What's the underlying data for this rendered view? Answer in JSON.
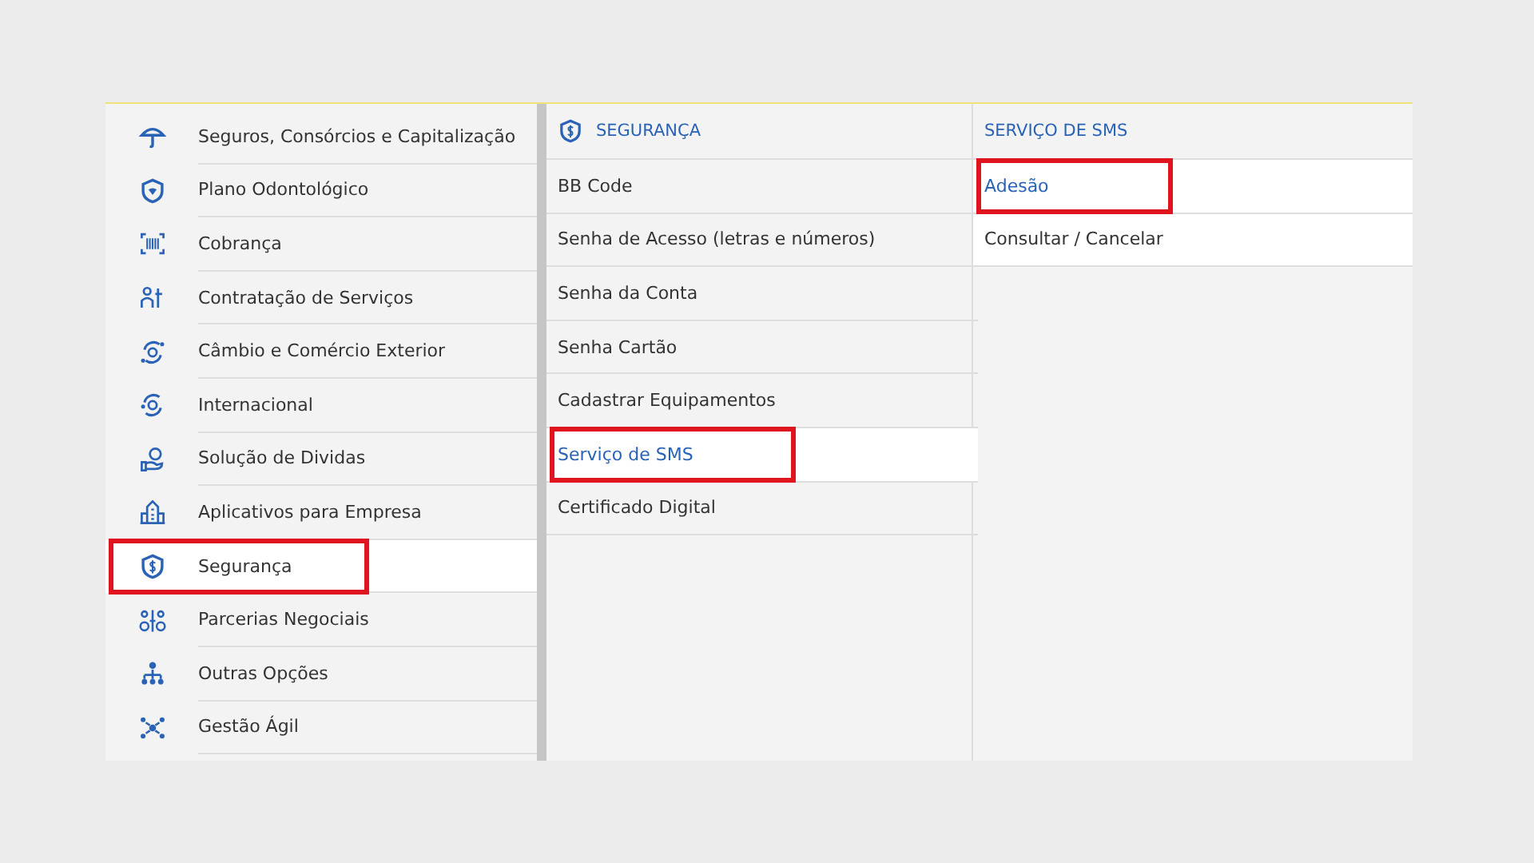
{
  "categories": [
    {
      "label": "Seguros, Consórcios e Capitalização",
      "selected": false
    },
    {
      "label": "Plano Odontológico",
      "selected": false
    },
    {
      "label": "Cobrança",
      "selected": false
    },
    {
      "label": "Contratação de Serviços",
      "selected": false
    },
    {
      "label": "Câmbio e Comércio Exterior",
      "selected": false
    },
    {
      "label": "Internacional",
      "selected": false
    },
    {
      "label": "Solução de Dividas",
      "selected": false
    },
    {
      "label": "Aplicativos para Empresa",
      "selected": false
    },
    {
      "label": "Segurança",
      "selected": true
    },
    {
      "label": "Parcerias Negociais",
      "selected": false
    },
    {
      "label": "Outras Opções",
      "selected": false
    },
    {
      "label": "Gestão Ágil",
      "selected": false
    }
  ],
  "submenu": {
    "title": "SEGURANÇA",
    "items": [
      {
        "label": "BB Code",
        "selected": false
      },
      {
        "label": "Senha de Acesso (letras e números)",
        "selected": false
      },
      {
        "label": "Senha da Conta",
        "selected": false
      },
      {
        "label": "Senha Cartão",
        "selected": false
      },
      {
        "label": "Cadastrar Equipamentos",
        "selected": false
      },
      {
        "label": "Serviço de SMS",
        "selected": true
      },
      {
        "label": "Certificado Digital",
        "selected": false
      }
    ]
  },
  "actions": {
    "title": "SERVIÇO DE SMS",
    "items": [
      {
        "label": "Adesão",
        "selected": true
      },
      {
        "label": "Consultar / Cancelar",
        "selected": false
      }
    ]
  }
}
